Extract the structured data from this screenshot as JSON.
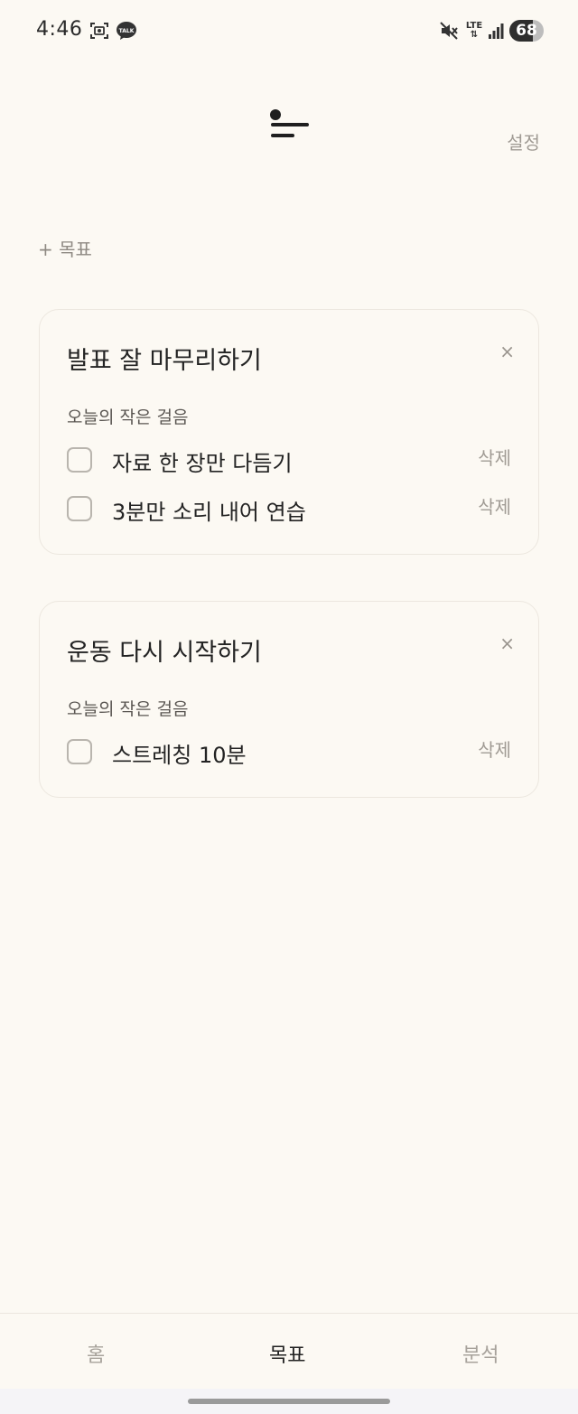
{
  "status_bar": {
    "time": "4:46",
    "network": "LTE",
    "battery": "68",
    "battery_level": 0.68
  },
  "header": {
    "settings_label": "설정"
  },
  "add_goal_label": "+ 목표",
  "goals": [
    {
      "title": "발표 잘 마무리하기",
      "close": "×",
      "steps_label": "오늘의 작은 걸음",
      "steps": [
        {
          "text": "자료 한 장만 다듬기",
          "delete": "삭제",
          "checked": false
        },
        {
          "text": "3분만 소리 내어 연습",
          "delete": "삭제",
          "checked": false
        }
      ]
    },
    {
      "title": "운동 다시 시작하기",
      "close": "×",
      "steps_label": "오늘의 작은 걸음",
      "steps": [
        {
          "text": "스트레칭 10분",
          "delete": "삭제",
          "checked": false
        }
      ]
    }
  ],
  "bottom_nav": {
    "items": [
      {
        "label": "홈",
        "active": false
      },
      {
        "label": "목표",
        "active": true
      },
      {
        "label": "분석",
        "active": false
      }
    ]
  },
  "colors": {
    "background": "#fcf9f3",
    "text_primary": "#232323",
    "text_muted": "#a09b94",
    "border": "#ece7df"
  },
  "icons": [
    "screenshot-icon",
    "kakaotalk-icon",
    "mute-icon",
    "lte-icon",
    "signal-icon",
    "battery-icon",
    "app-logo-icon",
    "checkbox-icon"
  ]
}
